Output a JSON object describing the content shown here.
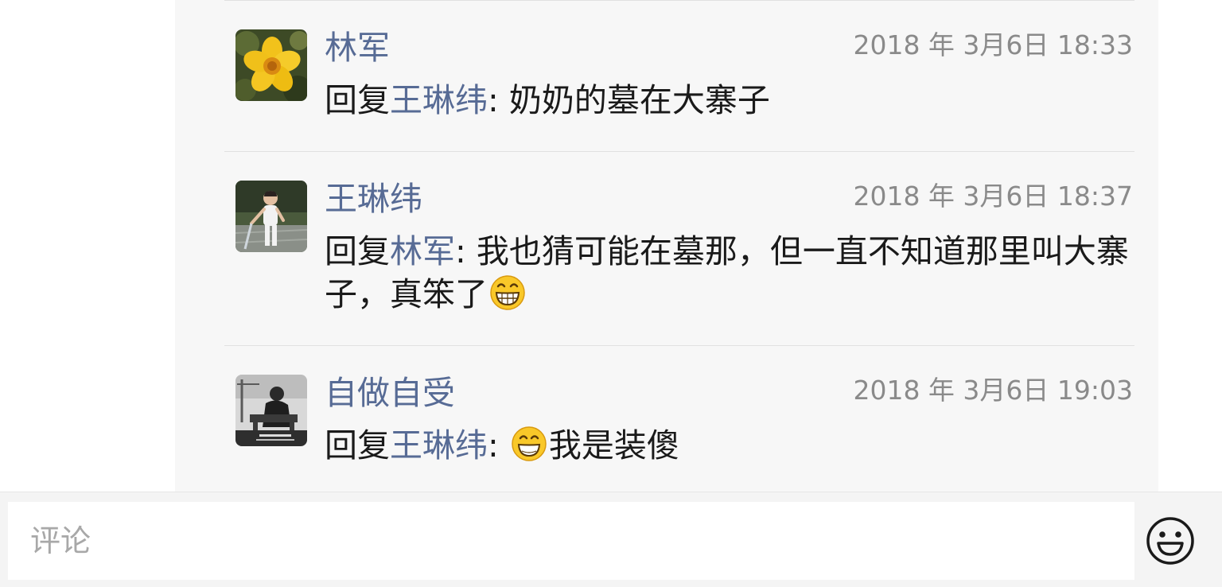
{
  "comments": [
    {
      "author": "林军",
      "timestamp": "2018 年 3月6日 18:33",
      "reply_prefix": "回复",
      "reply_to": "王琳纬",
      "separator": ": ",
      "text": "奶奶的墓在大寨子",
      "avatar_icon": "yellow-flower"
    },
    {
      "author": "王琳纬",
      "timestamp": "2018 年 3月6日 18:37",
      "reply_prefix": "回复",
      "reply_to": "林军",
      "separator": ": ",
      "text": "我也猜可能在墓那，但一直不知道那里叫大寨子，真笨了",
      "text_emoji": "grinning-face-emoji",
      "avatar_icon": "child-photo"
    },
    {
      "author": "自做自受",
      "timestamp": "2018 年 3月6日 19:03",
      "reply_prefix": "回复",
      "reply_to": "王琳纬",
      "separator": ": ",
      "text": "我是装傻",
      "leading_emoji": "smiling-face-emoji",
      "avatar_icon": "bw-workshop-photo"
    }
  ],
  "input": {
    "placeholder": "评论"
  },
  "emoji_button_icon": "smiley-icon",
  "colors": {
    "link": "#576b95",
    "text": "#1a1a1a",
    "timestamp": "#8a8a8a",
    "panel_bg": "#f7f7f7"
  }
}
